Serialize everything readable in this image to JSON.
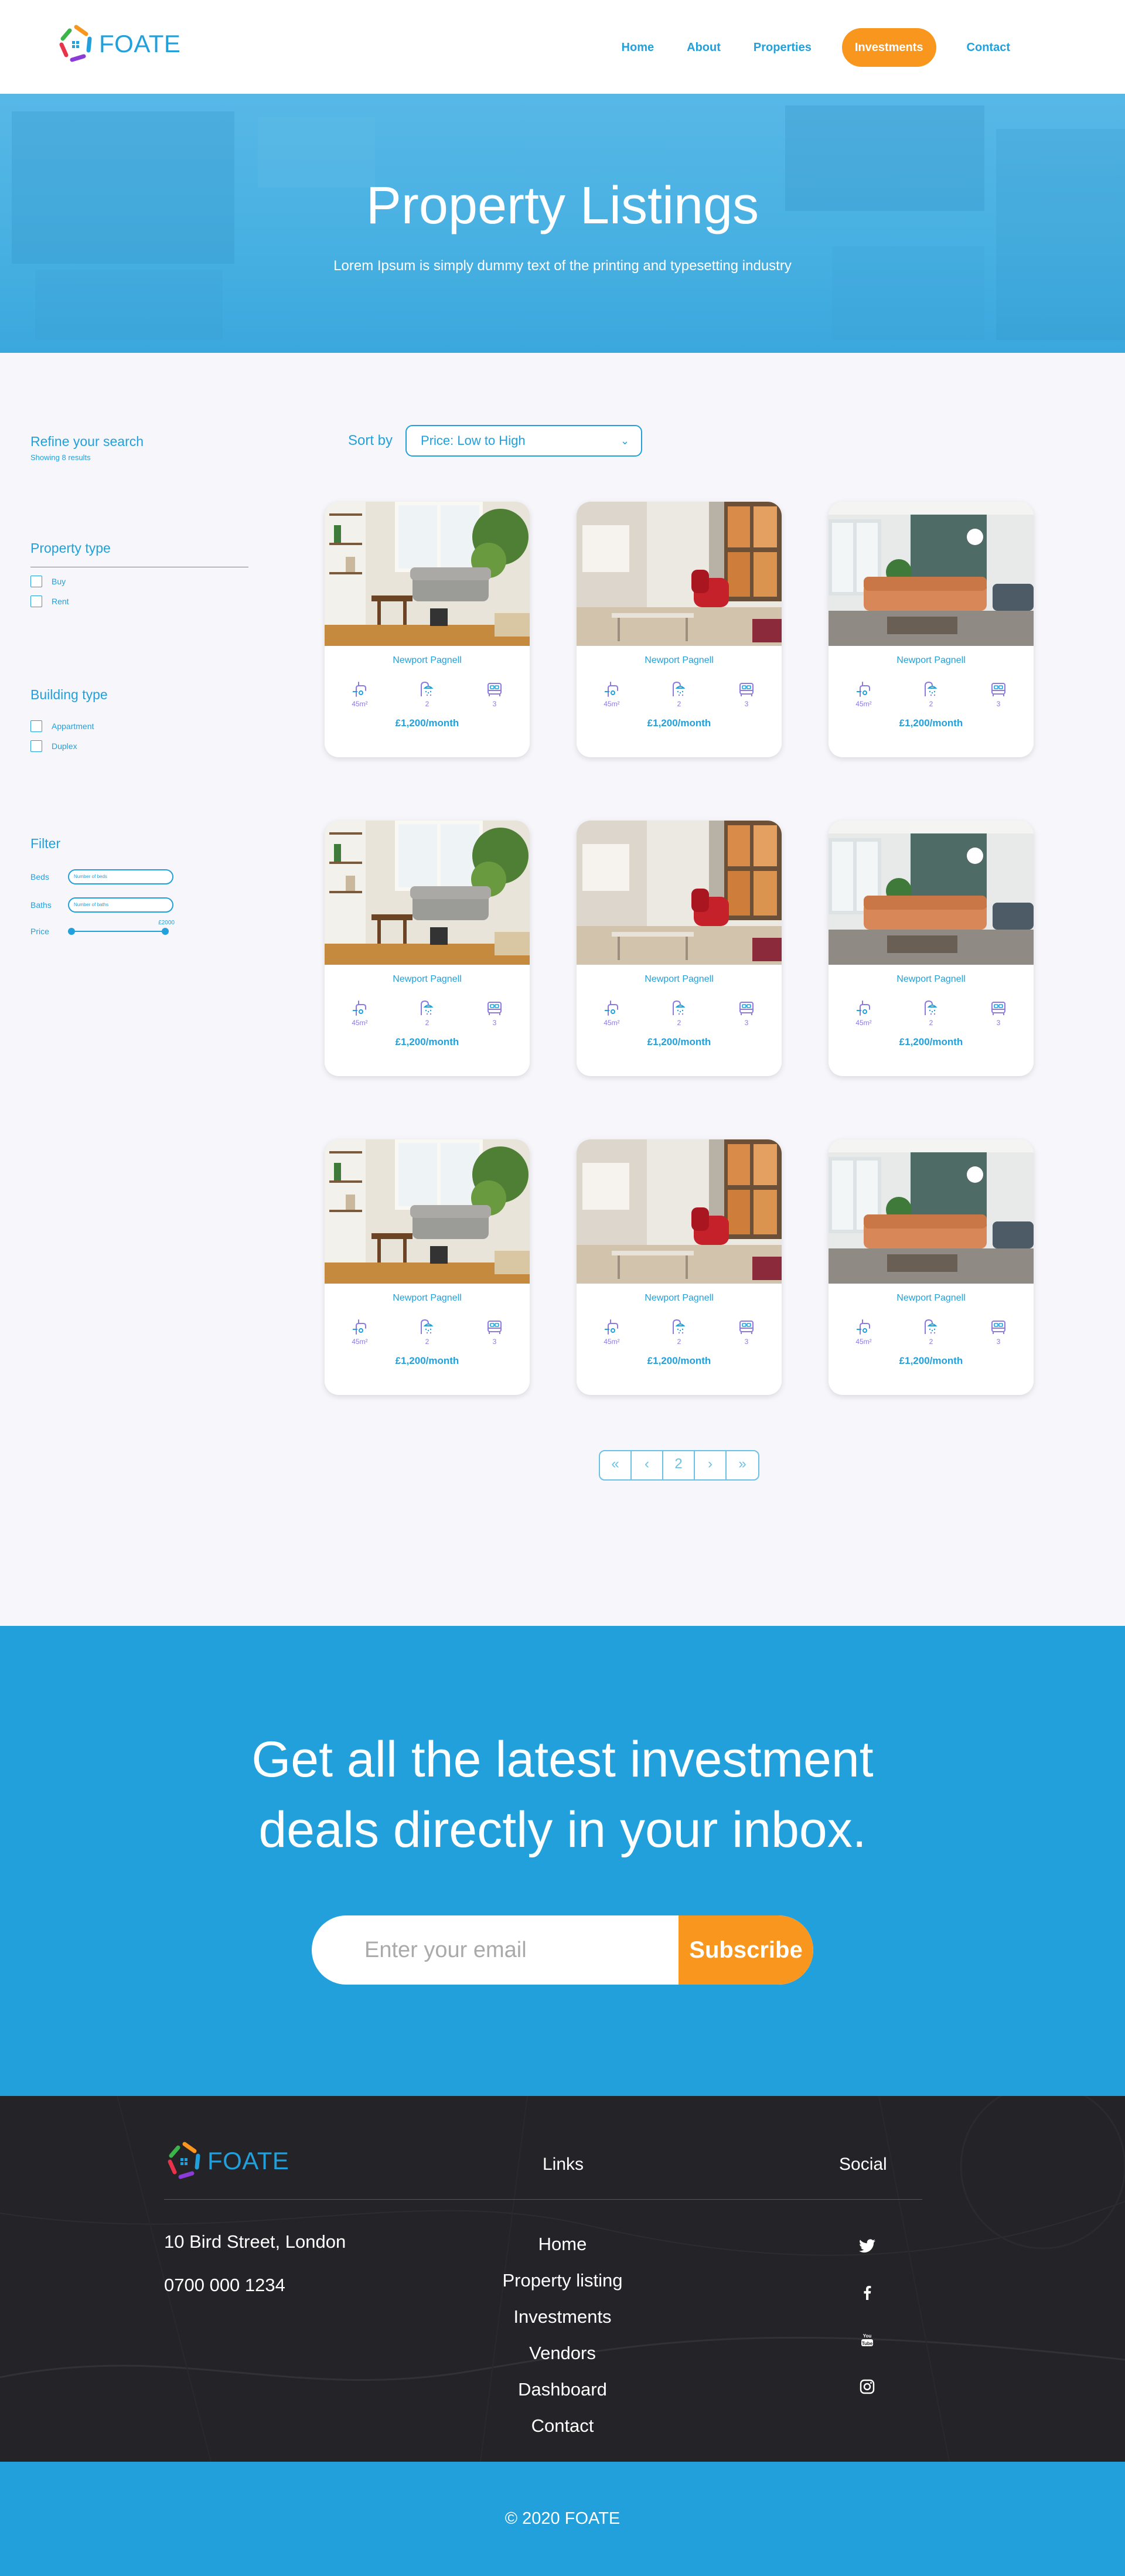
{
  "brand": {
    "name": "FOATE"
  },
  "nav": {
    "links": [
      {
        "label": "Home",
        "active": false
      },
      {
        "label": "About",
        "active": false
      },
      {
        "label": "Properties",
        "active": false
      },
      {
        "label": "Investments",
        "active": true
      },
      {
        "label": "Contact",
        "active": false
      }
    ]
  },
  "hero": {
    "title": "Property Listings",
    "subtitle": "Lorem Ipsum is simply dummy text of the printing and typesetting industry"
  },
  "sidebar": {
    "heading": "Refine your search",
    "results": "Showing 8 results",
    "property_type": {
      "heading": "Property type",
      "options": [
        "Buy",
        "Rent"
      ]
    },
    "building_type": {
      "heading": "Building type",
      "options": [
        "Appartment",
        "Duplex"
      ]
    },
    "filter": {
      "heading": "Filter",
      "beds_label": "Beds",
      "beds_placeholder": "Number of beds",
      "baths_label": "Baths",
      "baths_placeholder": "Number of baths",
      "price_label": "Price",
      "price_max": "£2000"
    }
  },
  "sort": {
    "label": "Sort by",
    "value": "Price: Low to High"
  },
  "cards": [
    {
      "location": "Newport Pagnell",
      "size": "45m²",
      "baths": "2",
      "beds": "3",
      "price": "£1,200/month",
      "image": "living-room-plants"
    },
    {
      "location": "Newport Pagnell",
      "size": "45m²",
      "baths": "2",
      "beds": "3",
      "price": "£1,200/month",
      "image": "living-room-red-chair"
    },
    {
      "location": "Newport Pagnell",
      "size": "45m²",
      "baths": "2",
      "beds": "3",
      "price": "£1,200/month",
      "image": "living-room-orange-sofa"
    },
    {
      "location": "Newport Pagnell",
      "size": "45m²",
      "baths": "2",
      "beds": "3",
      "price": "£1,200/month",
      "image": "living-room-plants"
    },
    {
      "location": "Newport Pagnell",
      "size": "45m²",
      "baths": "2",
      "beds": "3",
      "price": "£1,200/month",
      "image": "living-room-red-chair"
    },
    {
      "location": "Newport Pagnell",
      "size": "45m²",
      "baths": "2",
      "beds": "3",
      "price": "£1,200/month",
      "image": "living-room-orange-sofa"
    },
    {
      "location": "Newport Pagnell",
      "size": "45m²",
      "baths": "2",
      "beds": "3",
      "price": "£1,200/month",
      "image": "living-room-plants"
    },
    {
      "location": "Newport Pagnell",
      "size": "45m²",
      "baths": "2",
      "beds": "3",
      "price": "£1,200/month",
      "image": "living-room-red-chair"
    },
    {
      "location": "Newport Pagnell",
      "size": "45m²",
      "baths": "2",
      "beds": "3",
      "price": "£1,200/month",
      "image": "living-room-orange-sofa"
    }
  ],
  "pagination": {
    "first": "«",
    "prev": "‹",
    "current": "2",
    "next": "›",
    "last": "»"
  },
  "newsletter": {
    "title_line1": "Get all the latest investment",
    "title_line2": "deals directly in your inbox.",
    "placeholder": "Enter your email",
    "button": "Subscribe"
  },
  "footer": {
    "address": "10 Bird Street, London",
    "phone": "0700 000 1234",
    "links_heading": "Links",
    "links": [
      "Home",
      "Property listing",
      "Investments",
      "Vendors",
      "Dashboard",
      "Contact"
    ],
    "social_heading": "Social",
    "social": [
      "twitter-icon",
      "facebook-icon",
      "youtube-icon",
      "instagram-icon"
    ],
    "copyright": "© 2020 FOATE"
  },
  "colors": {
    "primary": "#21a0db",
    "accent": "#f8961e",
    "footer_bg": "#242428",
    "icon_purple": "#8a7be0"
  }
}
